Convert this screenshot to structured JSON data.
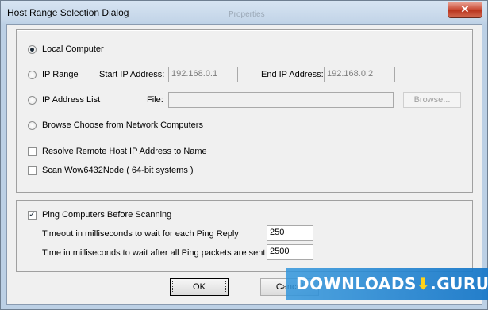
{
  "window": {
    "title": "Host Range Selection Dialog",
    "faint_title": "Properties",
    "close_symbol": "✕"
  },
  "host_range": {
    "local_computer": {
      "label": "Local Computer",
      "selected": true
    },
    "ip_range": {
      "label": "IP Range",
      "selected": false,
      "start_label": "Start IP Address:",
      "start_value": "192.168.0.1",
      "end_label": "End IP Address:",
      "end_value": "192.168.0.2"
    },
    "ip_list": {
      "label": "IP Address List",
      "selected": false,
      "file_label": "File:",
      "file_value": "",
      "browse_label": "Browse..."
    },
    "browse_network": {
      "label": "Browse Choose from Network Computers",
      "selected": false
    },
    "resolve_names": {
      "label": "Resolve Remote Host IP Address to Name",
      "checked": false
    },
    "scan_wow": {
      "label": "Scan Wow6432Node ( 64-bit systems )",
      "checked": false
    }
  },
  "ping": {
    "ping_before": {
      "label": "Ping Computers Before Scanning",
      "checked": true
    },
    "timeout_label": "Timeout in milliseconds to wait for each Ping Reply",
    "timeout_value": "250",
    "wait_label": "Time in milliseconds to wait after all Ping packets are sent",
    "wait_value": "2500"
  },
  "buttons": {
    "ok": "OK",
    "cancel": "Cancel"
  },
  "watermark": {
    "text": "DOWNLOADS",
    "arrow": "⬇",
    "suffix": ".GURU"
  }
}
